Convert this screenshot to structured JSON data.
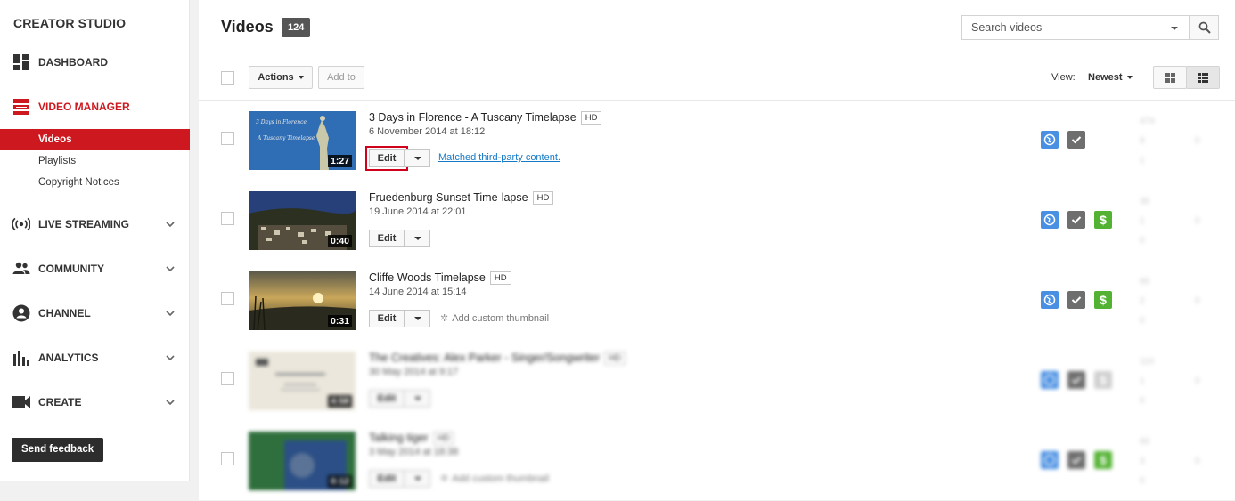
{
  "sidebar": {
    "title": "CREATOR STUDIO",
    "dashboard": "DASHBOARD",
    "video_manager": "VIDEO MANAGER",
    "sub_items": [
      "Videos",
      "Playlists",
      "Copyright Notices"
    ],
    "live_streaming": "LIVE STREAMING",
    "community": "COMMUNITY",
    "channel": "CHANNEL",
    "analytics": "ANALYTICS",
    "create": "CREATE",
    "feedback": "Send feedback"
  },
  "header": {
    "title": "Videos",
    "count": "124",
    "search_placeholder": "Search videos"
  },
  "toolbar": {
    "actions": "Actions",
    "add_to": "Add to",
    "view_label": "View:",
    "sort": "Newest"
  },
  "videos": [
    {
      "title": "3 Days in Florence - A Tuscany Timelapse",
      "hd": "HD",
      "date": "6 November 2014 at 18:12",
      "duration": "1:27",
      "edit": "Edit",
      "aux": "Matched third-party content.",
      "stats": [
        "474",
        "9",
        "0",
        "1"
      ]
    },
    {
      "title": "Fruedenburg Sunset Time-lapse",
      "hd": "HD",
      "date": "19 June 2014 at 22:01",
      "duration": "0:40",
      "edit": "Edit",
      "aux": "",
      "stats": [
        "30",
        "1",
        "0",
        "0"
      ]
    },
    {
      "title": "Cliffe Woods Timelapse",
      "hd": "HD",
      "date": "14 June 2014 at 15:14",
      "duration": "0:31",
      "edit": "Edit",
      "aux": "Add custom thumbnail",
      "stats": [
        "60",
        "2",
        "0",
        "0"
      ]
    },
    {
      "title": "The Creatives: Alex Parker - Singer/Songwriter",
      "hd": "HD",
      "date": "30 May 2014 at 9:17",
      "duration": "4:58",
      "edit": "Edit",
      "aux": "",
      "stats": [
        "110",
        "1",
        "0",
        "0"
      ]
    },
    {
      "title": "Talking tiger",
      "hd": "HD",
      "date": "3 May 2014 at 18:38",
      "duration": "0:12",
      "edit": "Edit",
      "aux": "Add custom thumbnail",
      "stats": [
        "60",
        "3",
        "0",
        "0"
      ]
    }
  ],
  "colors": {
    "accent": "#cc181e",
    "public": "#4a90e2",
    "monetized": "#53b232",
    "check": "#6e6e6e"
  }
}
